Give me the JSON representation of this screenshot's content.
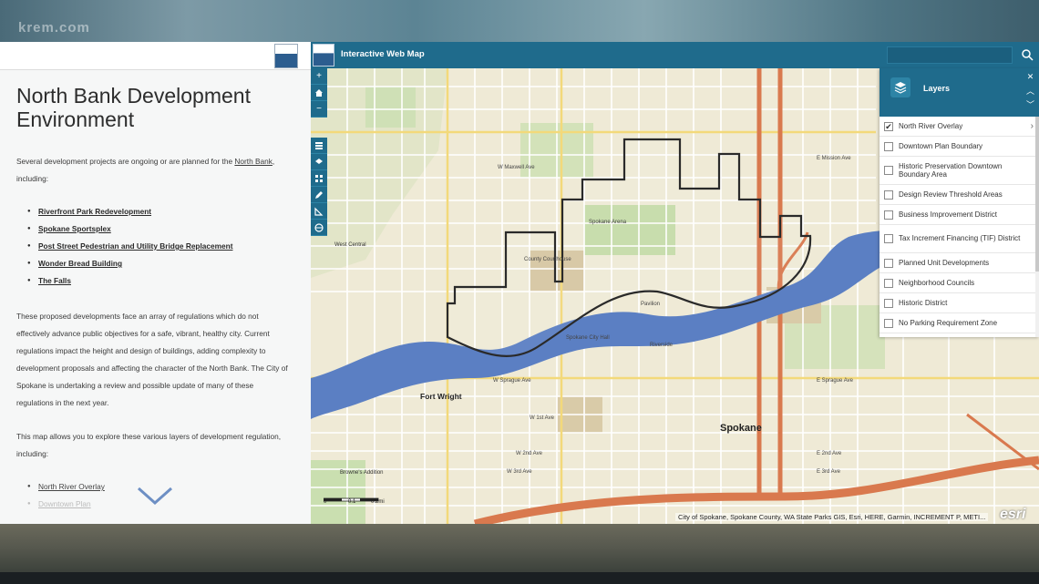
{
  "watermark": "krem.com",
  "story": {
    "title": "North Bank Development Environment",
    "intro_prefix": "Several development projects are ongoing or are planned for the ",
    "intro_link": "North Bank",
    "intro_suffix": ", including:",
    "projects": [
      "Riverfront Park Redevelopment",
      "Spokane Sportsplex",
      "Post Street Pedestrian and Utility Bridge Replacement",
      "Wonder Bread Building",
      "The Falls"
    ],
    "body": "These proposed developments face an array of regulations which do not effectively advance public objectives for a safe, vibrant, healthy city. Current regulations impact the height and design of buildings, adding complexity to development proposals and affecting the character of the North Bank. The City of Spokane is undertaking a review and possible update of many of these regulations in the next year.",
    "map_intro": "This map allows you to explore these various layers of development regulation, including:",
    "layer_links": [
      "North River Overlay",
      "Downtown Plan"
    ]
  },
  "map": {
    "app_title": "Interactive Web Map",
    "search_placeholder": "",
    "layers_title": "Layers",
    "layers": [
      {
        "label": "North River Overlay",
        "checked": true
      },
      {
        "label": "Downtown Plan Boundary",
        "checked": false
      },
      {
        "label": "Historic Preservation Downtown Boundary Area",
        "checked": false
      },
      {
        "label": "Design Review Threshold Areas",
        "checked": false
      },
      {
        "label": "Business Improvement District",
        "checked": false
      },
      {
        "label": "Tax Increment Financing (TIF) District",
        "checked": false
      },
      {
        "label": "Planned Unit Developments",
        "checked": false
      },
      {
        "label": "Neighborhood Councils",
        "checked": false
      },
      {
        "label": "Historic District",
        "checked": false
      },
      {
        "label": "No Parking Requirement Zone",
        "checked": false
      }
    ],
    "labels": {
      "spokane": "Spokane",
      "fort_wright": "Fort Wright",
      "west_central": "West Central",
      "browne_addition": "Browne's Addition",
      "w_maxwell": "W Maxwell Ave",
      "w_mission": "E Mission Ave",
      "w_sprague": "W Sprague Ave",
      "e_sprague": "E Sprague Ave",
      "w_1st": "W 1st Ave",
      "w_2nd": "W 2nd Ave",
      "w_3rd": "W 3rd Ave",
      "e_2nd": "E 2nd Ave",
      "e_3rd": "E 3rd Ave",
      "riverside": "Riverside",
      "pavilion": "Pavilion",
      "spokane_arena": "Spokane Arena",
      "spokane_city_hall": "Spokane City Hall",
      "county_courthouse": "County Courthouse"
    },
    "scale_labels": [
      "0",
      "0.1",
      "0.2mi"
    ],
    "attribution": "City of Spokane, Spokane County, WA State Parks GIS, Esri, HERE, Garmin, INCREMENT P, METI...",
    "esri": "esri"
  },
  "colors": {
    "header": "#1f6b8c",
    "river": "#5b7fc3",
    "overlay_outline": "#2a2a2a",
    "highway": "#d97a4f"
  }
}
